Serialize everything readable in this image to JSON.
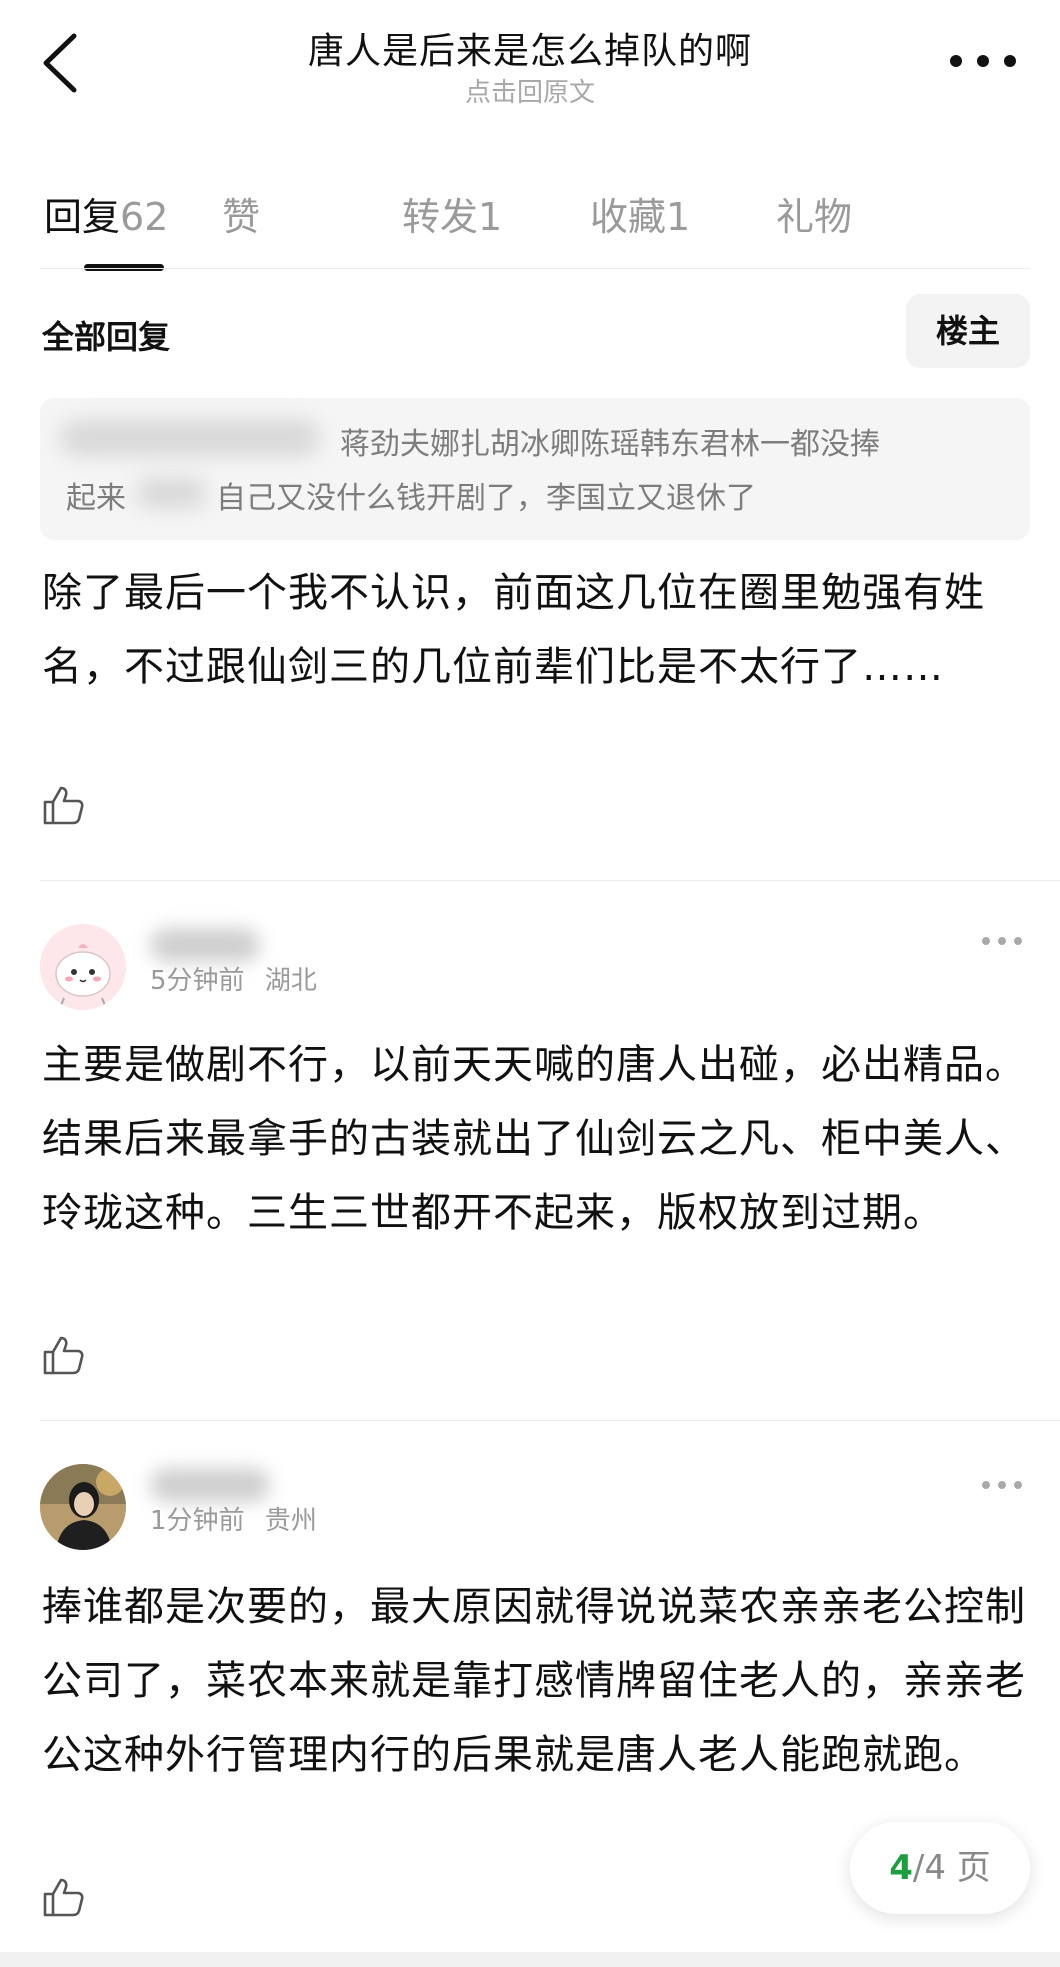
{
  "header": {
    "title": "唐人是后来是怎么掉队的啊",
    "subtitle": "点击回原文"
  },
  "tabs": [
    {
      "label": "回复",
      "count": "62",
      "active": true
    },
    {
      "label": "赞",
      "count": ""
    },
    {
      "label": "转发",
      "count": "1"
    },
    {
      "label": "收藏",
      "count": "1"
    },
    {
      "label": "礼物",
      "count": ""
    }
  ],
  "section": {
    "title": "全部回复",
    "owner_filter": "楼主"
  },
  "quoted": {
    "line1": "蒋劲夫娜扎胡冰卿陈瑶韩东君林一都没捧",
    "line2_a": "起来",
    "line2_b": "自己又没什么钱开剧了，李国立又退休了"
  },
  "replies": [
    {
      "text": "除了最后一个我不认识，前面这几位在圈里勉强有姓名，不过跟仙剑三的几位前辈们比是不太行了……"
    },
    {
      "time": "5分钟前",
      "location": "湖北",
      "text": "主要是做剧不行，以前天天喊的唐人出碰，必出精品。结果后来最拿手的古装就出了仙剑云之凡、柜中美人、玲珑这种。三生三世都开不起来，版权放到过期。"
    },
    {
      "time": "1分钟前",
      "location": "贵州",
      "text": "捧谁都是次要的，最大原因就得说说菜农亲亲老公控制公司了，菜农本来就是靠打感情牌留住老人的，亲亲老公这种外行管理内行的后果就是唐人老人能跑就跑。"
    }
  ],
  "pager": {
    "current": "4",
    "total": "/4 页"
  },
  "icons": [
    "back-arrow-icon",
    "more-dots-icon",
    "thumbs-up-icon",
    "avatar-cartoon-icon",
    "avatar-photo-icon"
  ],
  "colors": {
    "accent_green": "#1d9e3f",
    "muted_text": "#9a9a9a",
    "quote_bg": "#f5f5f5"
  }
}
